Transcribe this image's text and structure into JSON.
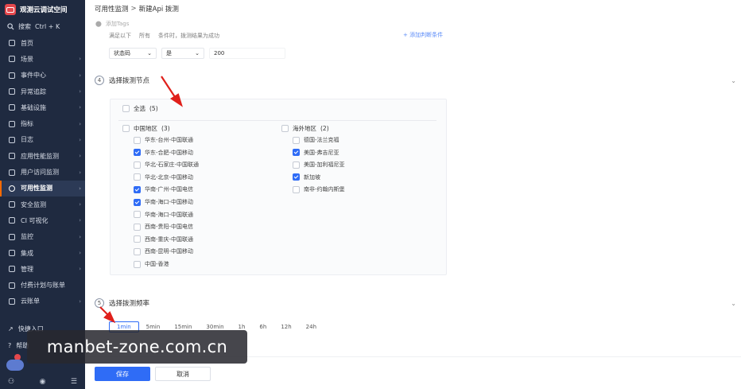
{
  "brand": {
    "name": "观测云调试空间"
  },
  "search": {
    "label": "搜索",
    "shortcut": "Ctrl + K"
  },
  "nav": [
    {
      "label": "首页",
      "icon": "home-icon",
      "arrow": false
    },
    {
      "label": "场景",
      "icon": "dashboard-icon",
      "arrow": true
    },
    {
      "label": "事件中心",
      "icon": "event-icon",
      "arrow": true
    },
    {
      "label": "异常追踪",
      "icon": "bug-icon",
      "arrow": true
    },
    {
      "label": "基础设施",
      "icon": "infra-icon",
      "arrow": true
    },
    {
      "label": "指标",
      "icon": "metric-icon",
      "arrow": true
    },
    {
      "label": "日志",
      "icon": "log-icon",
      "arrow": true
    },
    {
      "label": "应用性能监测",
      "icon": "apm-icon",
      "arrow": true
    },
    {
      "label": "用户访问监测",
      "icon": "rum-icon",
      "arrow": true
    },
    {
      "label": "可用性监测",
      "icon": "dialtest-icon",
      "arrow": true,
      "active": true
    },
    {
      "label": "安全监测",
      "icon": "security-icon",
      "arrow": true
    },
    {
      "label": "CI 可视化",
      "icon": "ci-icon",
      "arrow": true
    },
    {
      "label": "监控",
      "icon": "monitor-icon",
      "arrow": true
    },
    {
      "label": "集成",
      "icon": "integration-icon",
      "arrow": true
    },
    {
      "label": "管理",
      "icon": "settings-icon",
      "arrow": true
    },
    {
      "label": "付费计划与账单",
      "icon": "billing-icon",
      "arrow": false
    },
    {
      "label": "云账单",
      "icon": "cloud-bill-icon",
      "arrow": true
    }
  ],
  "bottom": {
    "quick_entry": "快捷入口",
    "help": "帮助"
  },
  "breadcrumb": {
    "parent": "可用性监测",
    "separator": ">",
    "current": "新建Api 拨测"
  },
  "tag": {
    "placeholder": "添加Tags"
  },
  "condition": {
    "prefix": "满足以下",
    "mode": "所有",
    "suffix": "条件时，拨测结果为成功",
    "add": "+ 添加判断条件"
  },
  "rule": {
    "field": "状态码",
    "op": "是",
    "value": "200"
  },
  "step4": {
    "number": "4",
    "title": "选择拨测节点"
  },
  "step5": {
    "number": "5",
    "title": "选择拨测频率"
  },
  "nodes": {
    "select_all": "全选",
    "total": "(5)",
    "china": {
      "label": "中国地区",
      "count": "(3)",
      "items": [
        {
          "label": "华东-台州-中国联通",
          "checked": false
        },
        {
          "label": "华东-合肥-中国移动",
          "checked": true
        },
        {
          "label": "华北-石家庄-中国联通",
          "checked": false
        },
        {
          "label": "华北-北京-中国移动",
          "checked": false
        },
        {
          "label": "华南-广州-中国电信",
          "checked": true
        },
        {
          "label": "华南-海口-中国移动",
          "checked": true
        },
        {
          "label": "华南-海口-中国联通",
          "checked": false
        },
        {
          "label": "西南-贵阳-中国电信",
          "checked": false
        },
        {
          "label": "西南-重庆-中国联通",
          "checked": false
        },
        {
          "label": "西南-昆明-中国移动",
          "checked": false
        },
        {
          "label": "中国-香港",
          "checked": false
        }
      ]
    },
    "overseas": {
      "label": "海外地区",
      "count": "(2)",
      "items": [
        {
          "label": "德国-法兰克福",
          "checked": false
        },
        {
          "label": "美国-弗吉尼亚",
          "checked": true
        },
        {
          "label": "美国-加利福尼亚",
          "checked": false
        },
        {
          "label": "新加坡",
          "checked": true
        },
        {
          "label": "南非-约翰内斯堡",
          "checked": false
        }
      ]
    }
  },
  "frequency": {
    "options": [
      "1min",
      "5min",
      "15min",
      "30min",
      "1h",
      "6h",
      "12h",
      "24h"
    ],
    "selected": "1min"
  },
  "footer": {
    "save": "保存",
    "cancel": "取消"
  },
  "watermark": {
    "text": "manbet-zone.com.cn"
  },
  "colors": {
    "sidebar": "#1f2a40",
    "primary": "#2f6cf6",
    "annotation_arrow": "#e0201b"
  }
}
